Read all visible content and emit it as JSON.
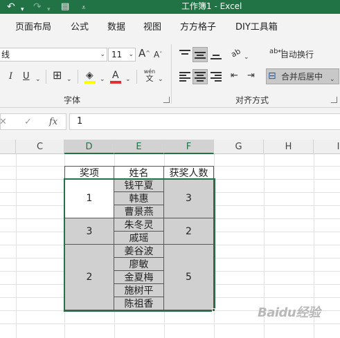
{
  "titlebar": {
    "undo_icon": "undo-icon",
    "redo_icon": "redo-icon",
    "save_icon": "save-icon",
    "customize_icon": "customize-quick-access-icon",
    "title": "工作簿1  -  Excel"
  },
  "tabs": [
    "页面布局",
    "公式",
    "数据",
    "视图",
    "方方格子",
    "DIY工具箱"
  ],
  "ribbon": {
    "font_name": "线",
    "font_size": "11",
    "increase_font_label": "A",
    "decrease_font_label": "A",
    "italic_label": "I",
    "underline_label": "U",
    "font_color_label": "A",
    "phonetic_label_top": "wén",
    "phonetic_label_bottom": "文",
    "font_group_label": "字体",
    "wrap_text_label": "自动换行",
    "merge_center_label": "合并后居中",
    "alignment_group_label": "对齐方式",
    "orientation_label": "ab",
    "highlight_color": "#ffff00",
    "font_color": "#e03030"
  },
  "formula_bar": {
    "cancel_symbol": "✕",
    "enter_symbol": "✓",
    "fx_label": "fx",
    "value": "1"
  },
  "columns": [
    "C",
    "D",
    "E",
    "F",
    "G",
    "H",
    "I"
  ],
  "table": {
    "headers": [
      "奖项",
      "姓名",
      "获奖人数"
    ],
    "groups": [
      {
        "award": "1",
        "names": [
          "钱平夏",
          "韩惠",
          "曹景燕"
        ],
        "count": "3"
      },
      {
        "award": "3",
        "names": [
          "朱冬灵",
          "戚瑶"
        ],
        "count": "2"
      },
      {
        "award": "2",
        "names": [
          "姜谷波",
          "廖敏",
          "金夏梅",
          "施树平",
          "陈祖香"
        ],
        "count": "5"
      }
    ]
  },
  "colors": {
    "excel_green": "#217346",
    "merged_fill": "#d0d0d0"
  },
  "watermark": "Baidu经验"
}
